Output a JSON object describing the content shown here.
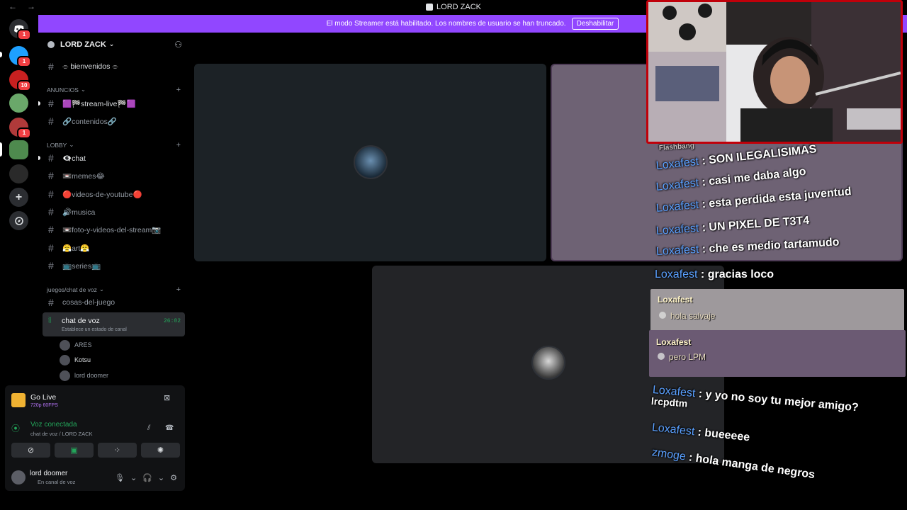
{
  "window": {
    "title": "LORD ZACK",
    "back_glyph": "←",
    "forward_glyph": "→"
  },
  "banner": {
    "message": "El modo Streamer está habilitado. Los nombres de usuario se han truncado.",
    "button_label": "Deshabilitar",
    "close_glyph": "✕"
  },
  "rail": {
    "badges": [
      "1",
      "1",
      "10",
      "1"
    ]
  },
  "guild": {
    "name": "LORD ZACK"
  },
  "channels": {
    "bienvenidos": "⌯ bienvenidos ⌯",
    "cat_anuncios": "ANUNCIOS",
    "stream_live": "🟪🏁stream-live🏁🟪",
    "contenidos": "🔗contenidos🔗",
    "cat_lobby": "LOBBY",
    "chat": "👁‍🗨chat",
    "memes": "📼memes😂",
    "videos": "🔴videos-de-youtube🔴",
    "musica": "🔊musica",
    "foto": "📼foto-y-videos-del-stream📷",
    "art": "😤art😤",
    "series": "📺series📺",
    "cat_juegos": "juegos/chat de voz",
    "cosas": "cosas-del-juego"
  },
  "voice_channel": {
    "name": "chat de voz",
    "status": "Establece un estado de canal",
    "timer": "26:02",
    "users": [
      "ARES",
      "Kotsu",
      "lord doomer"
    ]
  },
  "panel": {
    "golive_title": "Go Live",
    "golive_sub": "720p 60FPS",
    "vc_title": "Voz conectada",
    "vc_sub": "chat de voz / LORD ZACK",
    "user_name": "lord doomer",
    "user_status": "En canal de voz"
  },
  "overlay_chat": {
    "top_label": "Flashbang",
    "lines": [
      {
        "user": "Loxafest",
        "msg": "SON ILEGALISIMAS"
      },
      {
        "user": "Loxafest",
        "msg": "casi me daba algo"
      },
      {
        "user": "Loxafest",
        "msg": "esta perdida esta juventud"
      },
      {
        "user": "Loxafest",
        "msg": "UN PIXEL DE T3T4"
      },
      {
        "user": "Loxafest",
        "msg": "che es medio tartamudo"
      },
      {
        "user": "Loxafest",
        "msg": "gracias loco"
      }
    ],
    "cards": [
      {
        "user": "Loxafest",
        "msg": "hola salvaje"
      },
      {
        "user": "Loxafest",
        "msg": "pero LPM"
      }
    ],
    "lower_lines": [
      {
        "user": "Loxafest",
        "msg": "y yo no soy tu mejor amigo?"
      },
      {
        "user": "",
        "msg": "lrcpdtm"
      },
      {
        "user": "Loxafest",
        "msg": "bueeeee"
      },
      {
        "user": "zmoge",
        "msg": "hola manga de negros"
      }
    ],
    "separator": " : "
  },
  "colors": {
    "banner": "#9147ff",
    "accent_green": "#23a55a",
    "chat_user": "#5aa0ff",
    "cam_border": "#c0000a"
  }
}
